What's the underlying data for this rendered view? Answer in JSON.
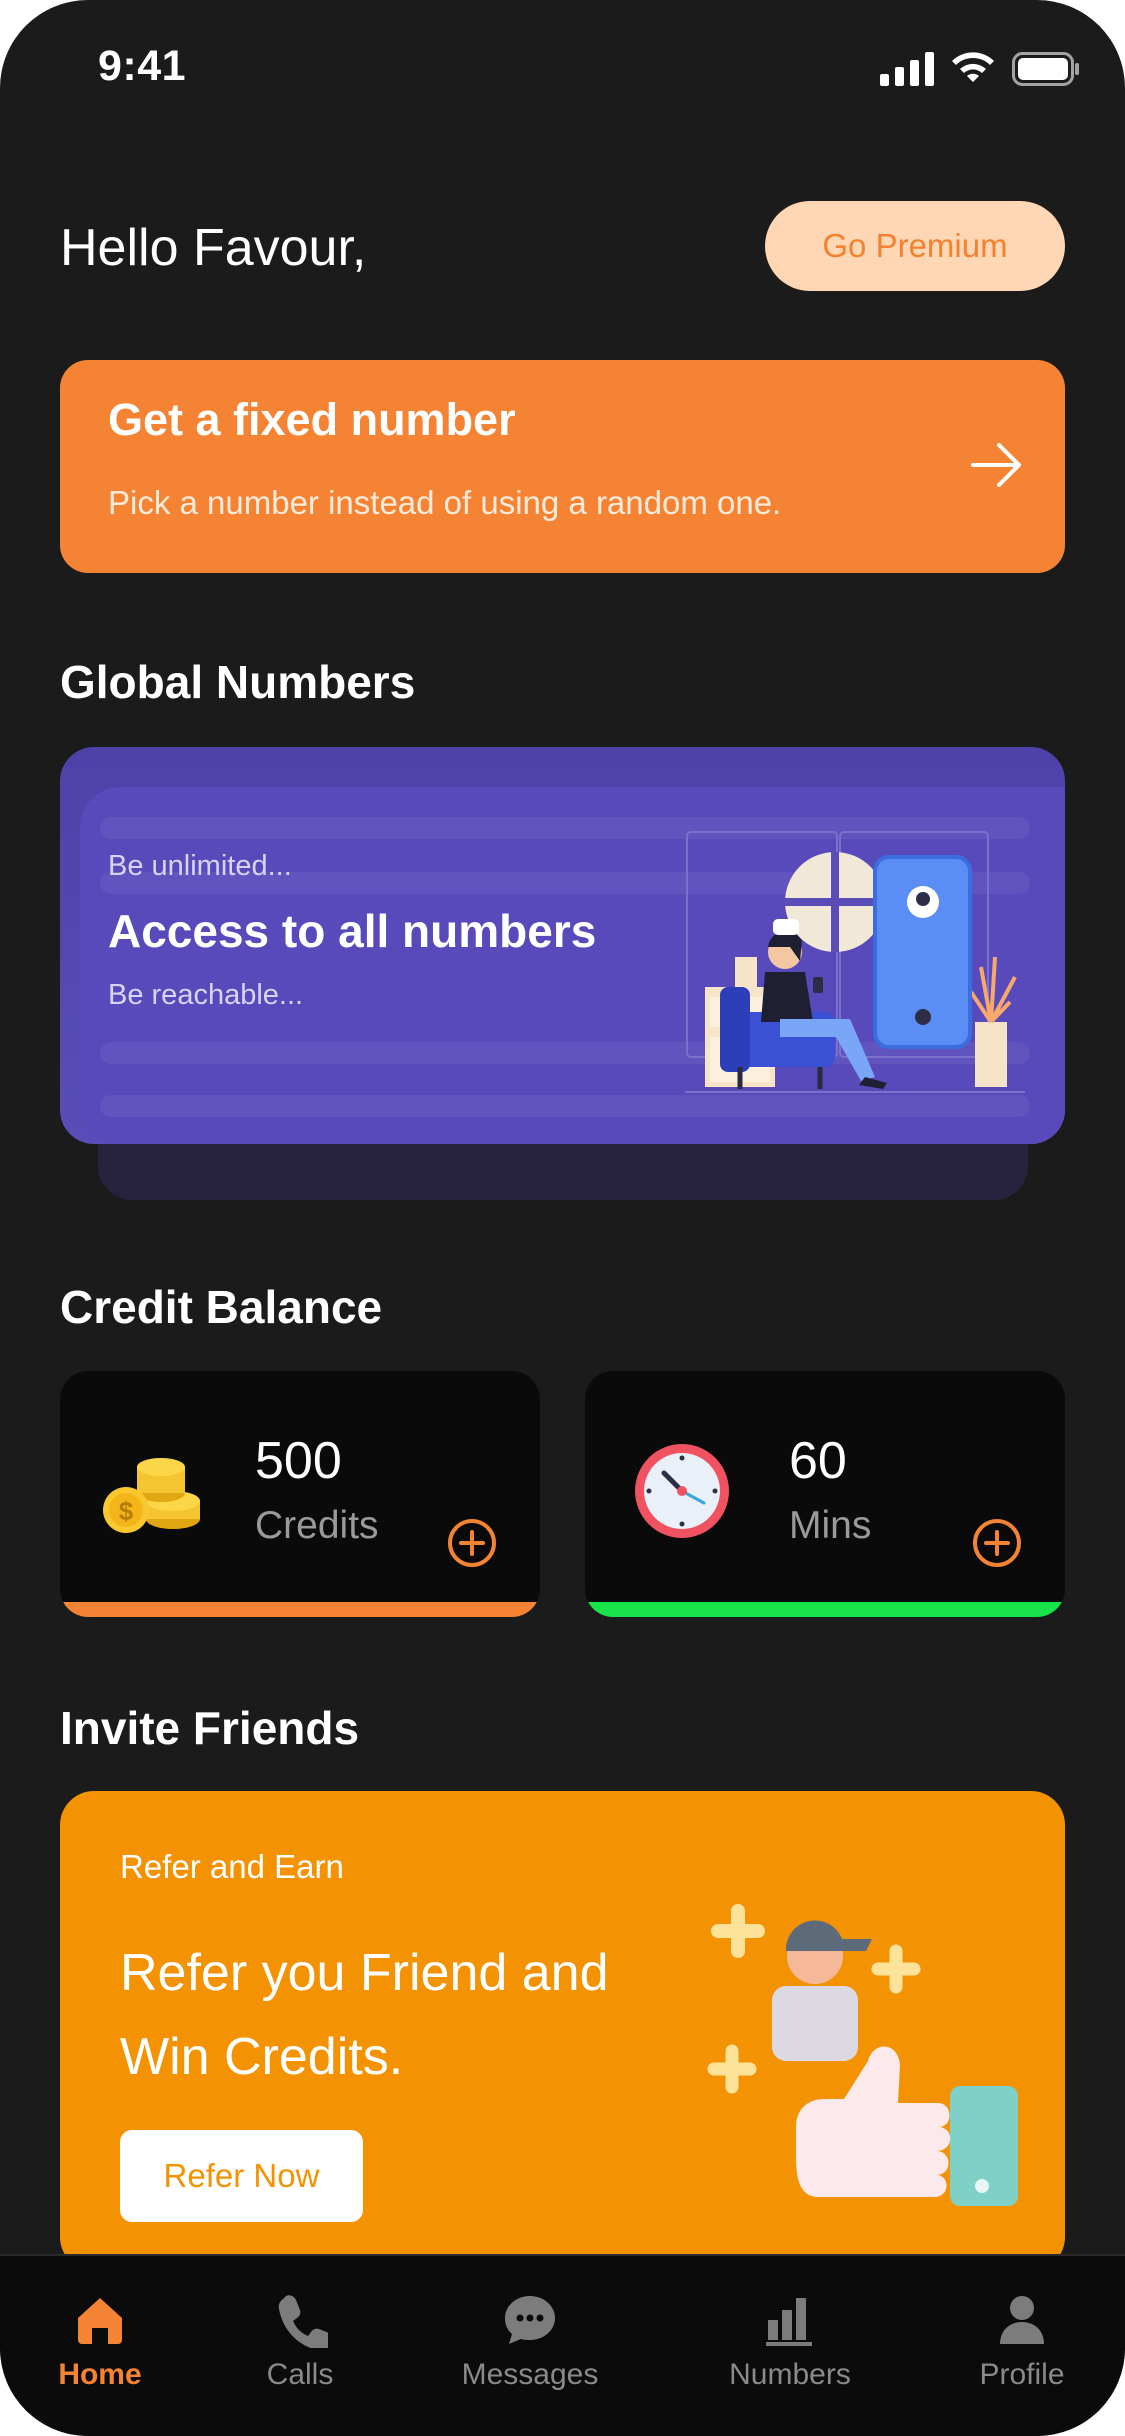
{
  "status": {
    "time": "9:41"
  },
  "header": {
    "greeting": "Hello Favour,",
    "premium_label": "Go Premium"
  },
  "fixed_number": {
    "title": "Get a fixed number",
    "subtitle": "Pick a number instead of using a random one."
  },
  "global": {
    "section_title": "Global Numbers",
    "tagline_top": "Be unlimited...",
    "headline": "Access to all numbers",
    "tagline_bottom": "Be reachable..."
  },
  "credit": {
    "section_title": "Credit Balance",
    "cards": [
      {
        "value": "500",
        "unit": "Credits",
        "bar_color": "#f48433",
        "icon": "coins-icon"
      },
      {
        "value": "60",
        "unit": "Mins",
        "bar_color": "#19e34a",
        "icon": "clock-icon"
      }
    ]
  },
  "invite": {
    "section_title": "Invite Friends",
    "small": "Refer and Earn",
    "headline": "Refer you Friend and Win Credits.",
    "button_label": "Refer Now"
  },
  "nav": {
    "items": [
      {
        "label": "Home",
        "icon": "home-icon"
      },
      {
        "label": "Calls",
        "icon": "phone-icon"
      },
      {
        "label": "Messages",
        "icon": "chat-icon"
      },
      {
        "label": "Numbers",
        "icon": "bar-chart-icon"
      },
      {
        "label": "Profile",
        "icon": "user-icon"
      }
    ],
    "active": "Home"
  },
  "colors": {
    "accent": "#f48433",
    "background": "#1b1b1b",
    "banner": "#5a4db8",
    "invite": "#f39304"
  }
}
